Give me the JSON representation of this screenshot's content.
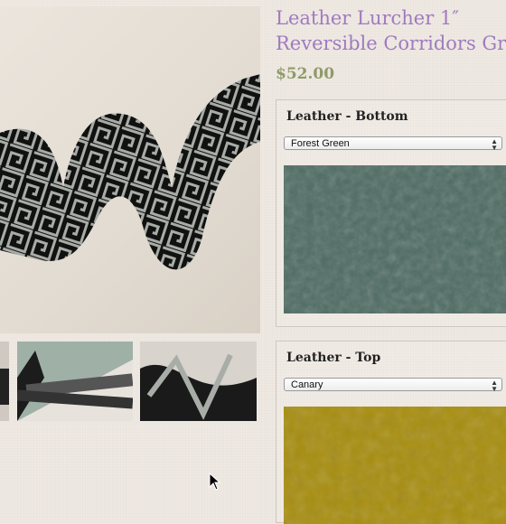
{
  "product": {
    "title_line1": "Leather Lurcher 1″",
    "title_line2": "Reversible Corridors Grey",
    "price": "$52.00"
  },
  "options": [
    {
      "title": "Leather - Bottom",
      "selected": "Forest Green",
      "swatch_color": "#4d6b62"
    },
    {
      "title": "Leather - Top",
      "selected": "Canary",
      "swatch_color": "#a78d0e"
    }
  ],
  "icons": {
    "select_arrows": "updown-chevron-icon",
    "cursor": "mouse-pointer-icon"
  }
}
